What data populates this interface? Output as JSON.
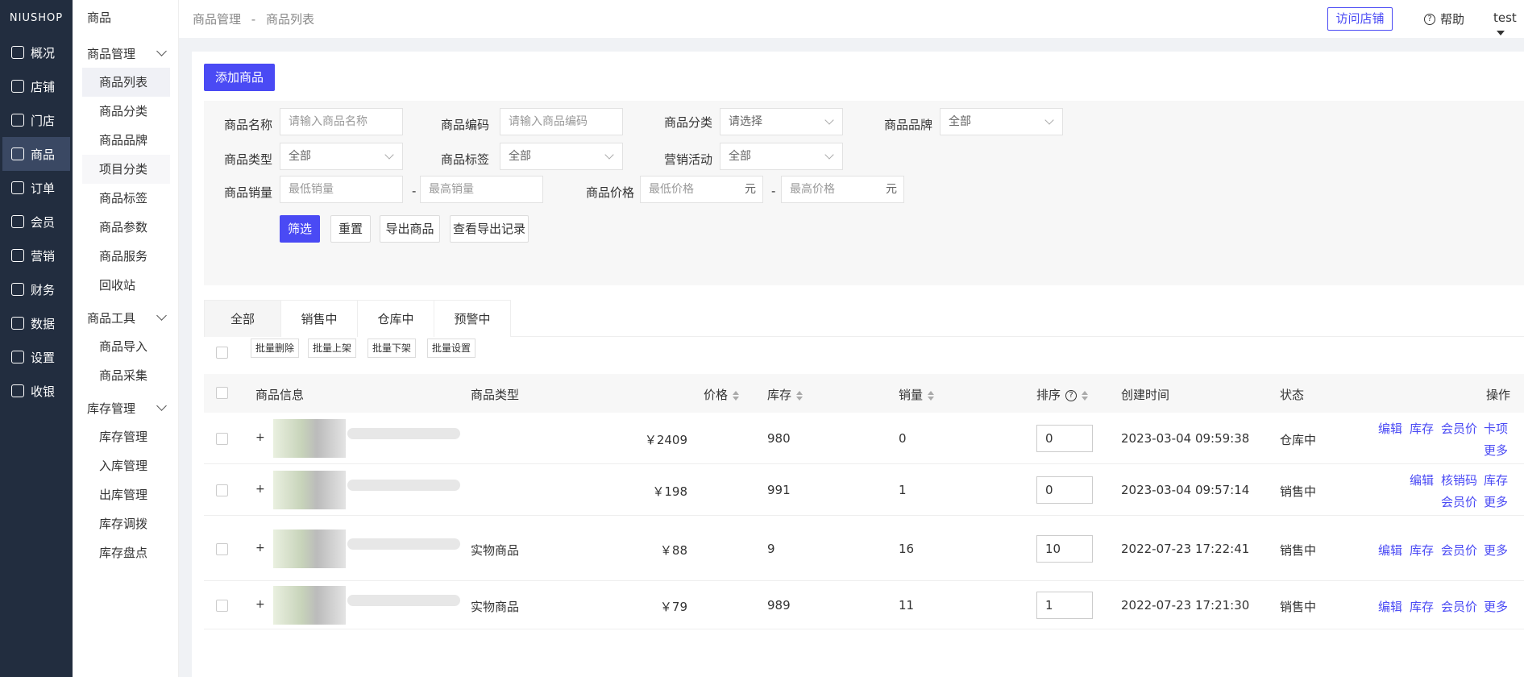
{
  "app": {
    "logo": "NIUSHOP"
  },
  "left_nav": [
    {
      "label": "概况",
      "icon": "chart-icon"
    },
    {
      "label": "店铺",
      "icon": "store-icon"
    },
    {
      "label": "门店",
      "icon": "shop-icon"
    },
    {
      "label": "商品",
      "icon": "goods-icon",
      "active": true
    },
    {
      "label": "订单",
      "icon": "order-icon"
    },
    {
      "label": "会员",
      "icon": "user-icon"
    },
    {
      "label": "营销",
      "icon": "marketing-icon"
    },
    {
      "label": "财务",
      "icon": "finance-icon"
    },
    {
      "label": "数据",
      "icon": "data-icon"
    },
    {
      "label": "设置",
      "icon": "settings-icon"
    },
    {
      "label": "收银",
      "icon": "cashier-icon"
    }
  ],
  "sub_nav": {
    "title": "商品",
    "groups": [
      {
        "label": "商品管理",
        "items": [
          "商品列表",
          "商品分类",
          "商品品牌",
          "项目分类",
          "商品标签",
          "商品参数",
          "商品服务",
          "回收站"
        ]
      },
      {
        "label": "商品工具",
        "items": [
          "商品导入",
          "商品采集"
        ]
      },
      {
        "label": "库存管理",
        "items": [
          "库存管理",
          "入库管理",
          "出库管理",
          "库存调拨",
          "库存盘点"
        ]
      }
    ]
  },
  "topbar": {
    "breadcrumb": [
      "商品管理",
      "-",
      "商品列表"
    ],
    "visit_store": "访问店铺",
    "help": "帮助",
    "user": "test"
  },
  "add_button": "添加商品",
  "filter": {
    "name_label": "商品名称",
    "name_placeholder": "请输入商品名称",
    "code_label": "商品编码",
    "code_placeholder": "请输入商品编码",
    "category_label": "商品分类",
    "category_value": "请选择",
    "brand_label": "商品品牌",
    "brand_value": "全部",
    "type_label": "商品类型",
    "type_value": "全部",
    "tag_label": "商品标签",
    "tag_value": "全部",
    "promo_label": "营销活动",
    "promo_value": "全部",
    "sales_label": "商品销量",
    "sales_min": "最低销量",
    "sales_max": "最高销量",
    "price_label": "商品价格",
    "price_min": "最低价格",
    "price_max": "最高价格",
    "unit": "元",
    "dash": "-",
    "filter_btn": "筛选",
    "reset_btn": "重置",
    "export_btn": "导出商品",
    "export_log_btn": "查看导出记录"
  },
  "tabs": [
    "全部",
    "销售中",
    "仓库中",
    "预警中"
  ],
  "bulk": [
    "批量删除",
    "批量上架",
    "批量下架",
    "批量设置"
  ],
  "table": {
    "headers": {
      "info": "商品信息",
      "type": "商品类型",
      "price": "价格",
      "stock": "库存",
      "sales": "销量",
      "sort": "排序",
      "created": "创建时间",
      "status": "状态",
      "ops": "操作"
    },
    "rows": [
      {
        "type": "",
        "price": "￥2409",
        "stock": "980",
        "sales": "0",
        "sort": "0",
        "created": "2023-03-04 09:59:38",
        "status": "仓库中",
        "ops": [
          "编辑",
          "库存",
          "会员价",
          "卡项",
          "更多"
        ]
      },
      {
        "type": "",
        "price": "￥198",
        "stock": "991",
        "sales": "1",
        "sort": "0",
        "created": "2023-03-04 09:57:14",
        "status": "销售中",
        "ops": [
          "编辑",
          "核销码",
          "库存",
          "会员价",
          "更多"
        ]
      },
      {
        "type": "实物商品",
        "price": "￥88",
        "stock": "9",
        "sales": "16",
        "sort": "10",
        "created": "2022-07-23 17:22:41",
        "status": "销售中",
        "ops": [
          "编辑",
          "库存",
          "会员价",
          "更多"
        ]
      },
      {
        "type": "实物商品",
        "price": "￥79",
        "stock": "989",
        "sales": "11",
        "sort": "1",
        "created": "2022-07-23 17:21:30",
        "status": "销售中",
        "ops": [
          "编辑",
          "库存",
          "会员价",
          "更多"
        ]
      }
    ]
  }
}
